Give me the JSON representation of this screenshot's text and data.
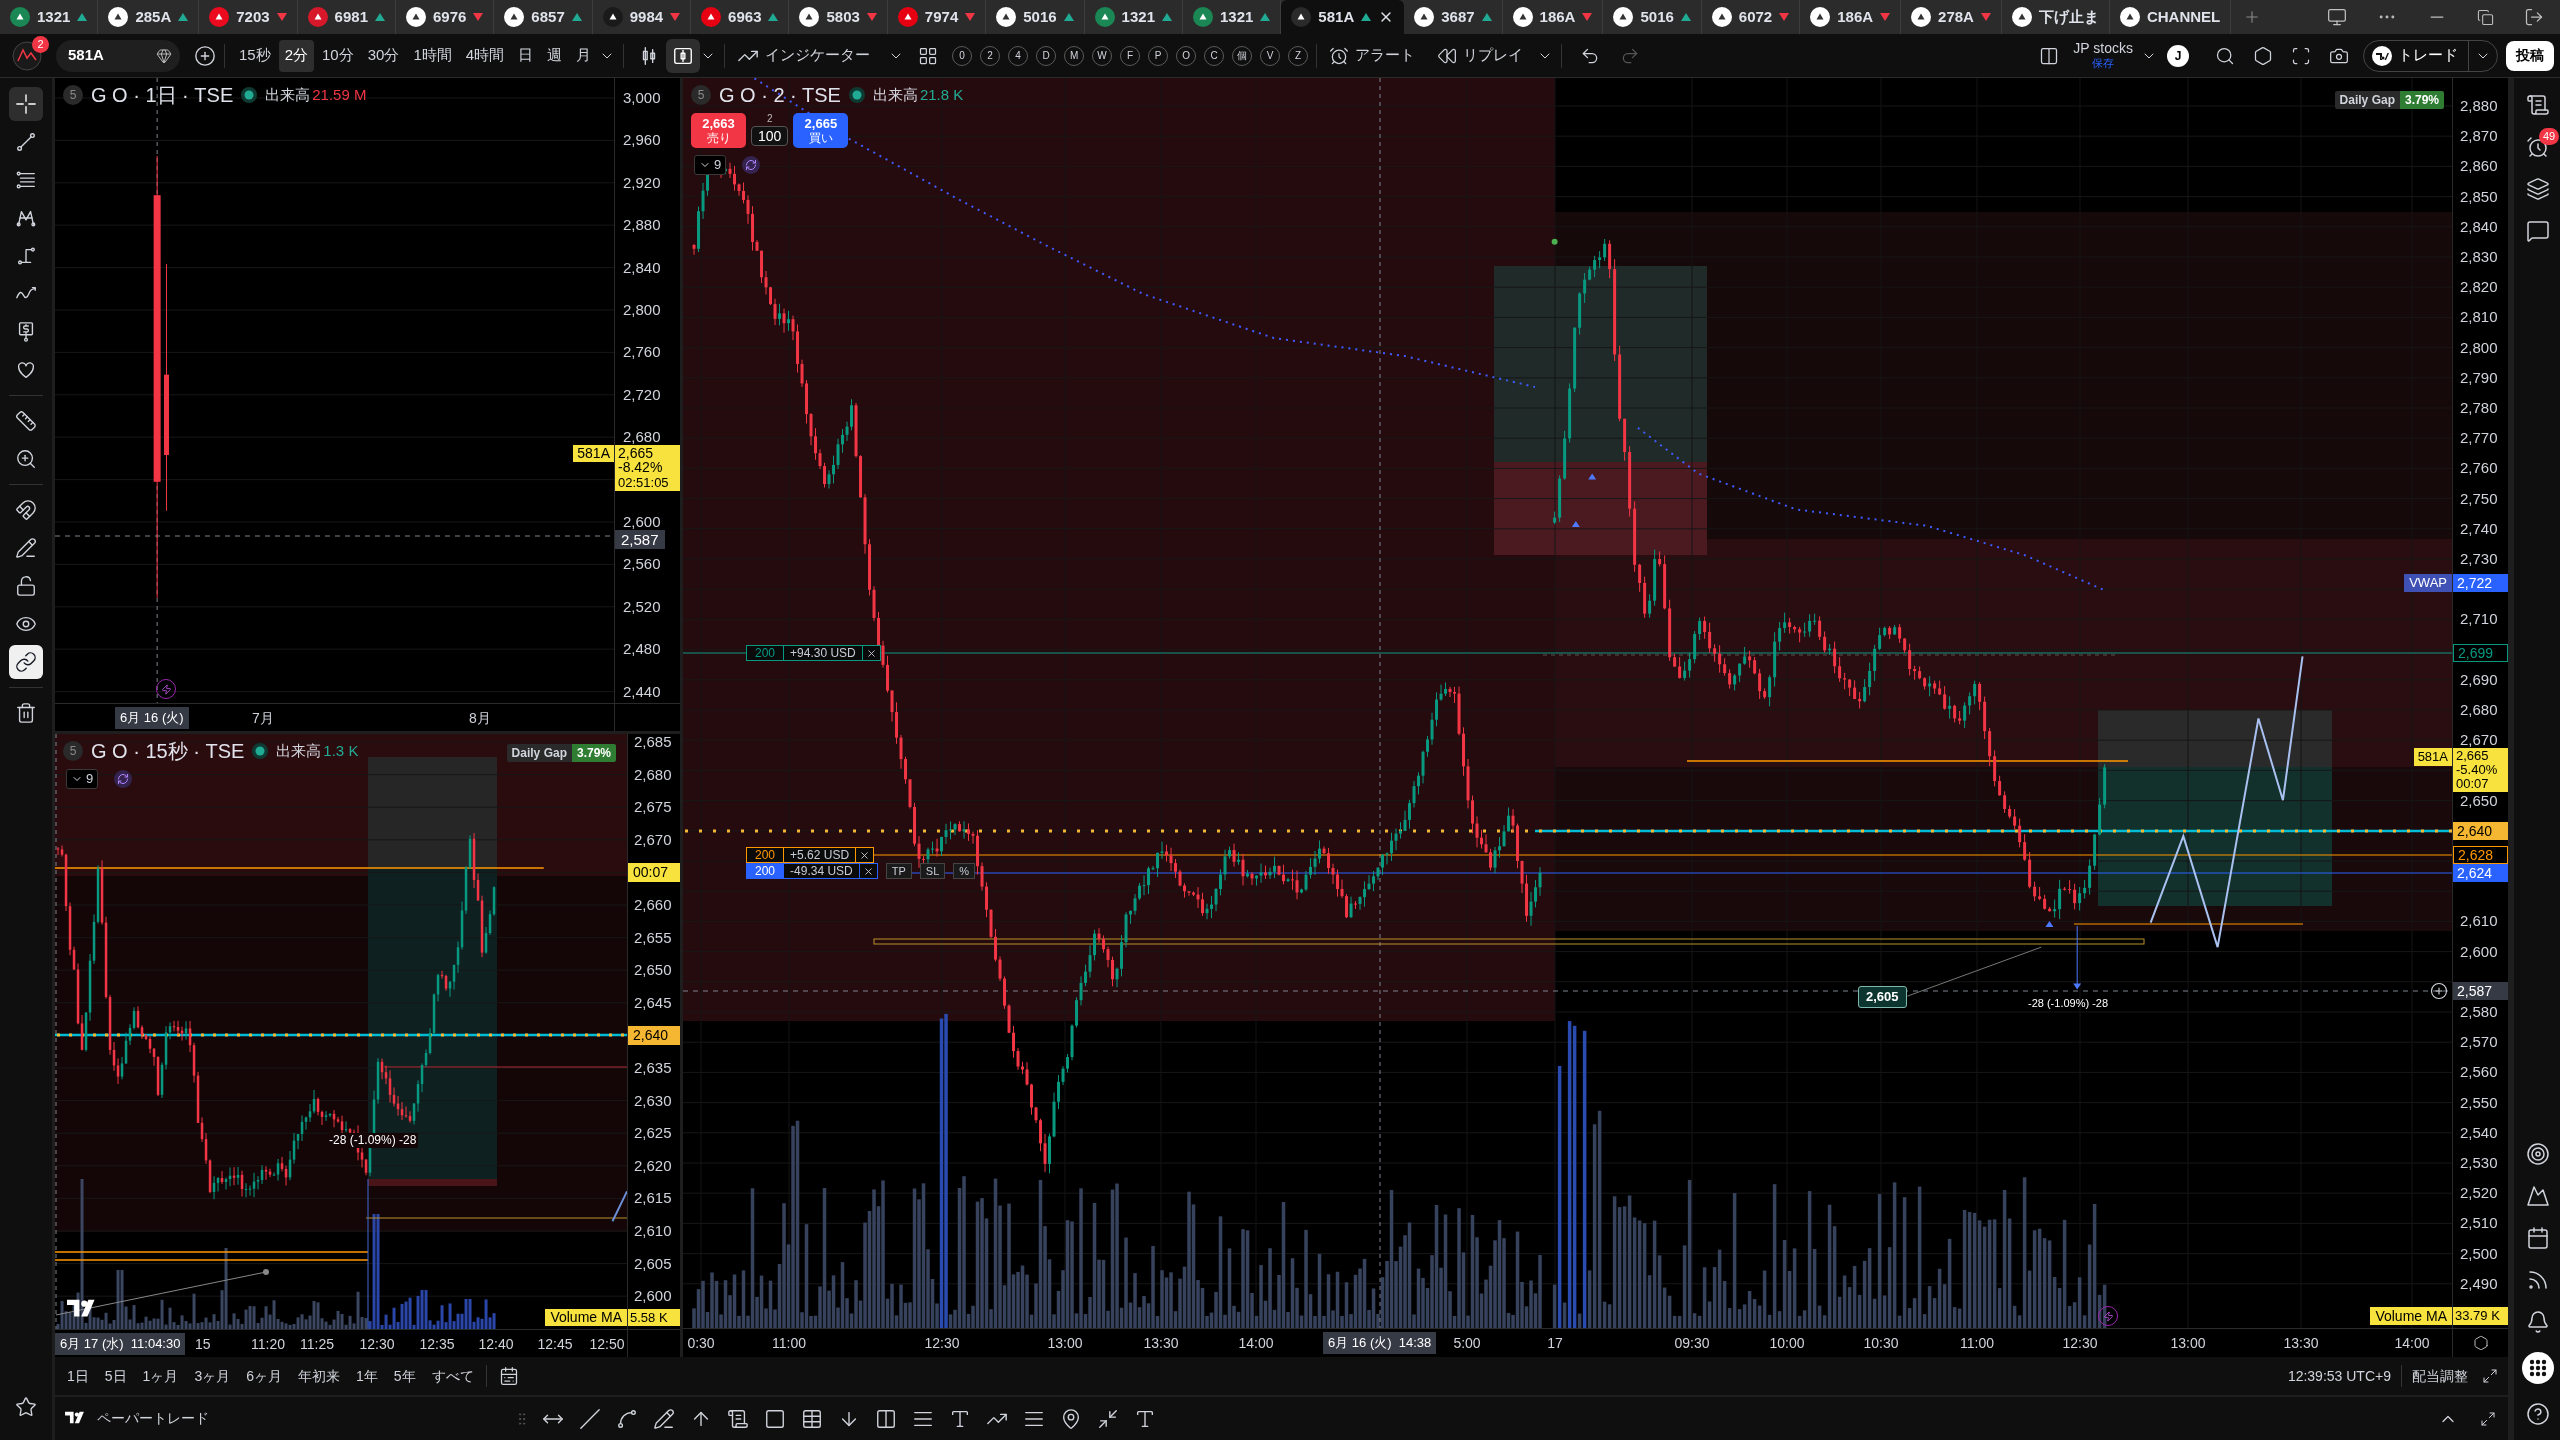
{
  "tab_bar": {
    "tabs": [
      {
        "symbol": "1321",
        "up": true,
        "color": "#1a8754",
        "selected": false
      },
      {
        "symbol": "285A",
        "up": true,
        "color": "#ffffff",
        "selected": false
      },
      {
        "symbol": "7203",
        "up": false,
        "color": "#eb0a1e",
        "selected": false
      },
      {
        "symbol": "6981",
        "up": true,
        "color": "#d7182a",
        "selected": false
      },
      {
        "symbol": "6976",
        "up": false,
        "color": "#ffffff",
        "selected": false
      },
      {
        "symbol": "6857",
        "up": true,
        "color": "#ffffff",
        "selected": false
      },
      {
        "symbol": "9984",
        "up": false,
        "color": "#1a1a1a",
        "selected": false
      },
      {
        "symbol": "6963",
        "up": true,
        "color": "#e60012",
        "selected": false
      },
      {
        "symbol": "5803",
        "up": false,
        "color": "#ffffff",
        "selected": false
      },
      {
        "symbol": "7974",
        "up": false,
        "color": "#e60012",
        "selected": false
      },
      {
        "symbol": "5016",
        "up": true,
        "color": "#ffffff",
        "selected": false
      },
      {
        "symbol": "1321",
        "up": true,
        "color": "#1a8754",
        "selected": false
      },
      {
        "symbol": "1321",
        "up": true,
        "color": "#1a8754",
        "selected": false
      },
      {
        "symbol": "581A",
        "up": true,
        "color": "#2a2a2a",
        "selected": true
      },
      {
        "symbol": "3687",
        "up": true,
        "color": "#ffffff",
        "selected": false
      },
      {
        "symbol": "186A",
        "up": false,
        "color": "#ffffff",
        "selected": false
      },
      {
        "symbol": "5016",
        "up": true,
        "color": "#ffffff",
        "selected": false
      },
      {
        "symbol": "6072",
        "up": false,
        "color": "#ffffff",
        "selected": false
      },
      {
        "symbol": "186A",
        "up": false,
        "color": "#ffffff",
        "selected": false
      },
      {
        "symbol": "278A",
        "up": false,
        "color": "#ffffff",
        "selected": false
      },
      {
        "symbol": "下げ止ま",
        "color": "#ffffff",
        "selected": false
      },
      {
        "symbol": "CHANNEL",
        "color": "#ffffff",
        "selected": false
      }
    ]
  },
  "toolbar": {
    "avatar_badge": "2",
    "symbol": "581A",
    "intervals": [
      {
        "label": "15秒",
        "selected": false
      },
      {
        "label": "2分",
        "selected": true
      },
      {
        "label": "10分",
        "selected": false
      },
      {
        "label": "30分",
        "selected": false
      },
      {
        "label": "1時間",
        "selected": false
      },
      {
        "label": "4時間",
        "selected": false
      },
      {
        "label": "日",
        "selected": false
      },
      {
        "label": "週",
        "selected": false
      },
      {
        "label": "月",
        "selected": false
      }
    ],
    "chart_types": [
      {
        "kind": "bars",
        "selected": false
      },
      {
        "kind": "candles",
        "selected": true
      }
    ],
    "indicators": "インジケーター",
    "shortcuts": [
      "0",
      "2",
      "4",
      "D",
      "M",
      "W",
      "F",
      "P",
      "O",
      "C",
      "個",
      "V",
      "Z"
    ],
    "alert": "アラート",
    "replay": "リプレイ",
    "layout": {
      "name": "JP stocks",
      "status": "保存"
    },
    "user_initial": "J",
    "trade": "トレード",
    "publish": "投稿"
  },
  "drawing_tools": [
    {
      "kind": "crosshair",
      "selected": true
    },
    {
      "kind": "trend-line",
      "selected": false
    },
    {
      "kind": "fib",
      "selected": false
    },
    {
      "kind": "pattern",
      "selected": false
    },
    {
      "kind": "projection",
      "selected": false
    },
    {
      "kind": "brush",
      "selected": false
    },
    {
      "kind": "price-note",
      "selected": false
    },
    {
      "kind": "favorite",
      "selected": false
    }
  ],
  "toggles": [
    {
      "kind": "magnet",
      "on": false
    },
    {
      "kind": "drawing-lock",
      "on": false
    },
    {
      "kind": "lock",
      "on": false
    },
    {
      "kind": "eye",
      "on": false
    },
    {
      "kind": "link",
      "on": true
    }
  ],
  "daily_chart": {
    "badge": "5",
    "title": "G O · 1日 · TSE",
    "volume_label": "出来高",
    "volume": "21.59 M",
    "volume_up": false,
    "price_axis": [
      "3,000",
      "2,960",
      "2,920",
      "2,880",
      "2,840",
      "2,800",
      "2,760",
      "2,720",
      "2,680",
      "2,600",
      "2,560",
      "2,520",
      "2,480",
      "2,440"
    ],
    "price_tag": {
      "symbol": "581A",
      "price": "2,665",
      "change": "-8.42%",
      "countdown": "02:51:05"
    },
    "crosshair": {
      "price": "2,587",
      "time": "6月 16 (火)"
    },
    "time_axis": [
      "7月",
      "8月"
    ]
  },
  "seconds_chart": {
    "badge": "5",
    "title": "G O · 15秒 · TSE",
    "volume_label": "出来高",
    "volume": "1.3 K",
    "volume_up": true,
    "daily_gap": {
      "label": "Daily Gap",
      "value": "3.79%"
    },
    "layers": "9",
    "price_axis": [
      "2,685",
      "2,680",
      "2,675",
      "2,670",
      "2,660",
      "2,655",
      "2,650",
      "2,645",
      "2,635",
      "2,630",
      "2,625",
      "2,620",
      "2,615",
      "2,610",
      "2,605",
      "2,600"
    ],
    "countdown": "00:07",
    "line_price": "2,640",
    "measure": "-28 (-1.09%) -28",
    "volume_ma": {
      "label": "Volume MA",
      "value": "5.58 K"
    },
    "crosshair": {
      "time": "6月 17 (水)  11:04:30"
    },
    "time_axis": [
      "15",
      "11:20",
      "11:25",
      "12:30",
      "12:35",
      "12:40",
      "12:45",
      "12:50"
    ]
  },
  "main_chart": {
    "badge": "5",
    "title": "G O · 2 · TSE",
    "volume_label": "出来高",
    "volume": "21.8 K",
    "volume_up": true,
    "order_panel": {
      "sell_price": "2,663",
      "sell_label": "売り",
      "spread": "2",
      "quantity": "100",
      "buy_price": "2,665",
      "buy_label": "買い"
    },
    "layers": "9",
    "daily_gap": {
      "label": "Daily Gap",
      "value": "3.79%"
    },
    "orders": [
      {
        "kind": "order",
        "quantity": "200",
        "pnl": "+94.30 USD",
        "color": "#089981"
      },
      {
        "kind": "order",
        "quantity": "200",
        "pnl": "+5.62 USD",
        "color": "#ff9800"
      },
      {
        "kind": "position",
        "quantity": "200",
        "pnl": "-49.34 USD",
        "color": "#2962ff",
        "buttons": [
          "TP",
          "SL",
          "%"
        ]
      }
    ],
    "price_axis": [
      "2,880",
      "2,870",
      "2,860",
      "2,850",
      "2,840",
      "2,830",
      "2,820",
      "2,810",
      "2,800",
      "2,790",
      "2,780",
      "2,770",
      "2,760",
      "2,750",
      "2,740",
      "2,730",
      "2,710",
      "2,690",
      "2,680",
      "2,670",
      "2,650",
      "2,610",
      "2,600",
      "2,580",
      "2,570",
      "2,560",
      "2,550",
      "2,540",
      "2,530",
      "2,520",
      "2,510",
      "2,500",
      "2,490"
    ],
    "tags": [
      {
        "kind": "vwap",
        "label": "VWAP",
        "price": "2,722"
      },
      {
        "kind": "outline",
        "price": "2,699",
        "color": "#089981"
      },
      {
        "kind": "last",
        "symbol": "581A",
        "price": "2,665",
        "change": "-5.40%",
        "countdown": "00:07"
      },
      {
        "kind": "filled",
        "price": "2,640",
        "color": "#f5b731"
      },
      {
        "kind": "outline",
        "price": "2,628",
        "color": "#ff9800"
      },
      {
        "kind": "filled",
        "price": "2,624",
        "color": "#2962ff"
      },
      {
        "kind": "crosshair",
        "price": "2,587"
      }
    ],
    "measure_start": "2,605",
    "measure": "-28 (-1.09%) -28",
    "volume_ma": {
      "label": "Volume MA",
      "value": "33.79 K"
    },
    "crosshair": {
      "time": "6月 16 (火)  14:38"
    },
    "time_axis": [
      "0:30",
      "11:00",
      "12:30",
      "13:00",
      "13:30",
      "14:00",
      "5:00",
      "17",
      "09:30",
      "10:00",
      "10:30",
      "11:00",
      "12:30",
      "13:00",
      "13:30",
      "14:00"
    ]
  },
  "right_sidebar": {
    "alerts_badge": "49"
  },
  "range_bar": {
    "ranges": [
      "1日",
      "5日",
      "1ヶ月",
      "3ヶ月",
      "6ヶ月",
      "年初来",
      "1年",
      "5年",
      "すべて"
    ],
    "clock": "12:39:53 UTC+9",
    "adjust": "配当調整"
  },
  "bottom_panel": {
    "title": "ペーパートレード"
  }
}
